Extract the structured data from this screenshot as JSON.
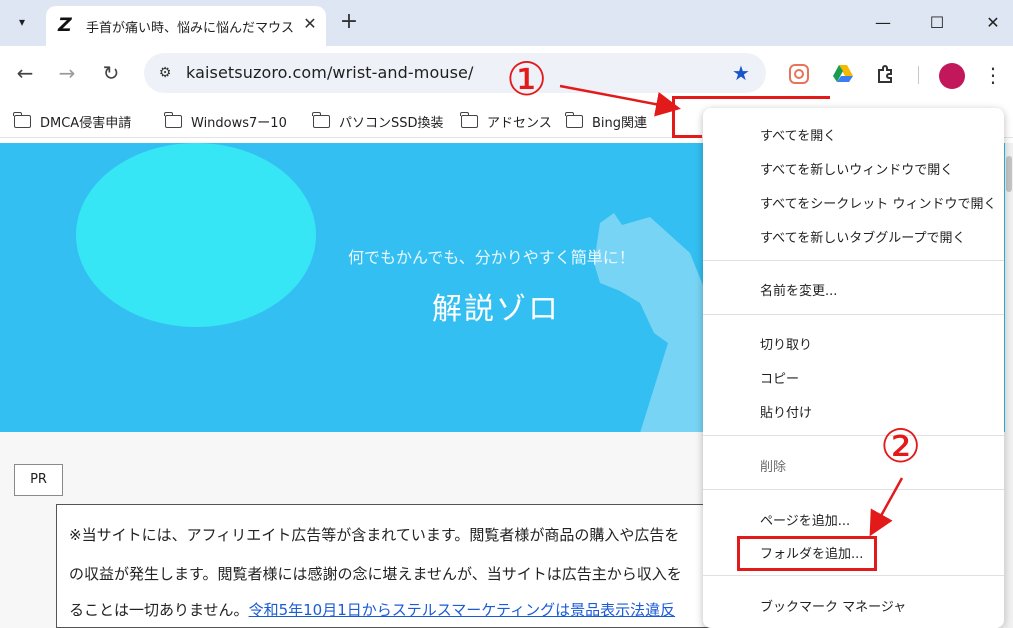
{
  "tab": {
    "title": "手首が痛い時、悩みに悩んだマウス",
    "favicon": "Z"
  },
  "icons": {
    "tab_search": "chevron-down-icon",
    "close": "close-icon",
    "new_tab": "plus-icon",
    "minimize": "minimize-icon",
    "maximize": "maximize-icon",
    "window_close": "close-icon",
    "back": "back-arrow-icon",
    "forward": "forward-arrow-icon",
    "reload": "reload-icon",
    "site_info": "tune-icon",
    "star": "star-icon",
    "folder": "folder-icon",
    "menu": "kebab-menu-icon"
  },
  "window": {
    "minimize_glyph": "—",
    "maximize_glyph": "☐",
    "close_glyph": "✕",
    "new_tab_glyph": "+",
    "tab_close_glyph": "✕"
  },
  "toolbar": {
    "url": "kaisetsuzoro.com/wrist-and-mouse/",
    "back_glyph": "←",
    "forward_glyph": "→",
    "reload_glyph": "↻",
    "star_glyph": "★",
    "menu_glyph": "⋮"
  },
  "bookmarks": [
    {
      "label": "DMCA侵害申請"
    },
    {
      "label": "Windows7ー10"
    },
    {
      "label": "パソコンSSD換装"
    },
    {
      "label": "アドセンス"
    },
    {
      "label": "Bing関連"
    }
  ],
  "page": {
    "tagline": "何でもかんでも、分かりやすく簡単に！",
    "site_name": "解説ゾロ",
    "pr_label": "PR",
    "notice_line1": "※当サイトには、アフィリエイト広告等が含まれています。閲覧者様が商品の購入や広告を",
    "notice_line2": "の収益が発生します。閲覧者様には感謝の念に堪えませんが、当サイトは広告主から収入を",
    "notice_line3_prefix": "ることは一切ありません。",
    "notice_line3_link": "令和5年10月1日からステルスマーケティングは景品表示法違反",
    "colors": {
      "hero": "#33bff1",
      "hero_circle": "#37e6f4"
    }
  },
  "menu": {
    "group1": [
      "すべてを開く",
      "すべてを新しいウィンドウで開く",
      "すべてをシークレット ウィンドウで開く",
      "すべてを新しいタブグループで開く"
    ],
    "group2": [
      "名前を変更..."
    ],
    "group3": [
      "切り取り",
      "コピー",
      "貼り付け"
    ],
    "group4": [
      "削除"
    ],
    "group5": [
      "ページを追加...",
      "フォルダを追加..."
    ],
    "group6": [
      "ブックマーク マネージャ"
    ]
  },
  "annotations": {
    "step1": "①",
    "step2": "②",
    "color": "#e31a1a"
  }
}
